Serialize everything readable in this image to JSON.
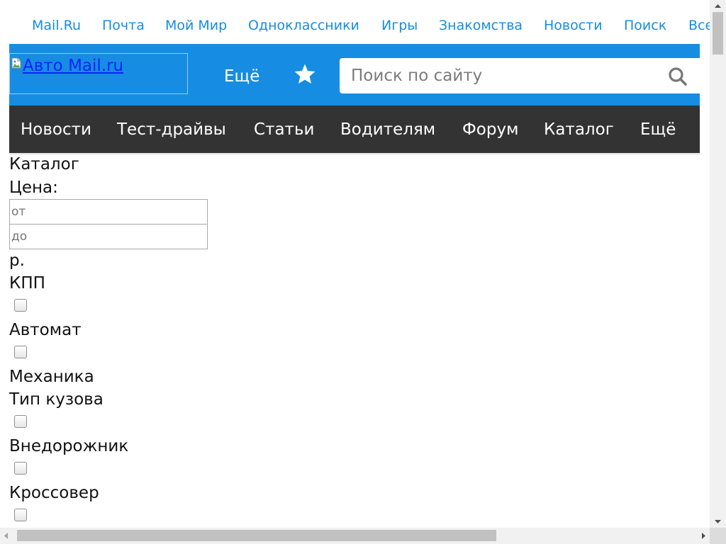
{
  "portal": {
    "links": [
      "Mail.Ru",
      "Почта",
      "Мой Мир",
      "Одноклассники",
      "Игры",
      "Знакомства",
      "Новости",
      "Поиск",
      "Все"
    ]
  },
  "header": {
    "logo_alt": "Авто Mail.ru",
    "more_label": "Ещё",
    "favorites_icon": "star-icon",
    "search_icon": "magnifier-icon",
    "search_placeholder": "Поиск по сайту",
    "background_color": "#168de2"
  },
  "nav": {
    "items": [
      "Новости",
      "Тест-драйвы",
      "Статьи",
      "Водителям",
      "Форум",
      "Каталог",
      "Ещё"
    ],
    "background_color": "#333333"
  },
  "catalog": {
    "title": "Каталог",
    "price": {
      "label": "Цена:",
      "from_placeholder": "от",
      "to_placeholder": "до",
      "currency": "р."
    },
    "transmission": {
      "label": "КПП",
      "options": [
        "Автомат",
        "Механика"
      ]
    },
    "body_type": {
      "label": "Тип кузова",
      "options": [
        "Внедорожник",
        "Кроссовер"
      ]
    }
  },
  "colors": {
    "link": "#168de2",
    "scrollbar_thumb": "#c1c1c1"
  }
}
